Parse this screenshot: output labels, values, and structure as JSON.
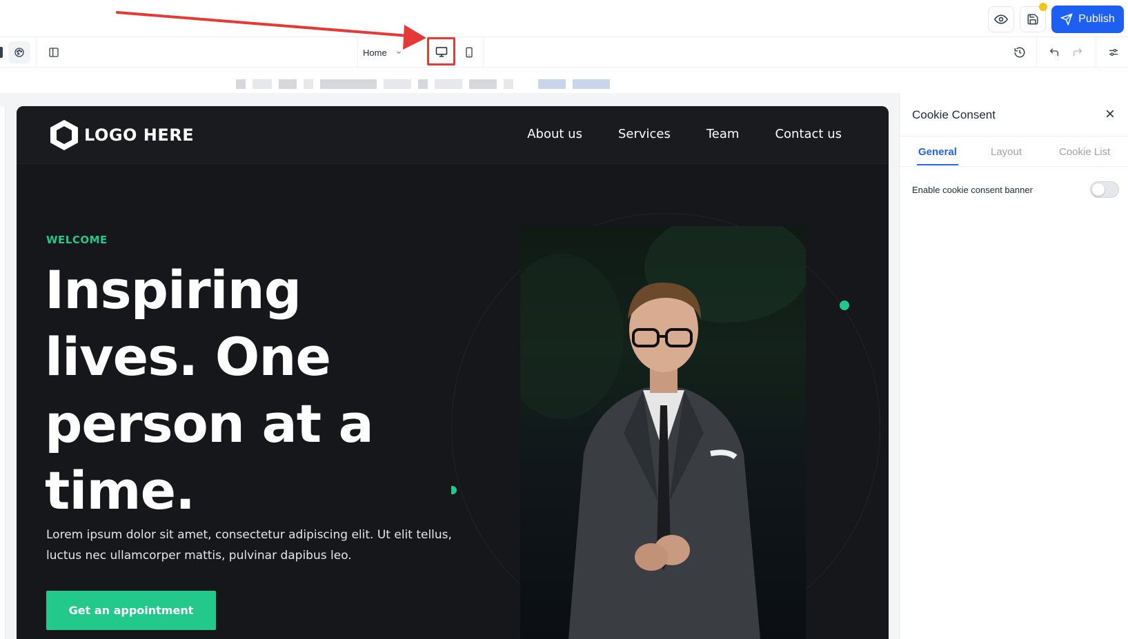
{
  "colors": {
    "accent_blue": "#1d5ff0",
    "brand_green": "#22c98a",
    "annotation_red": "#e53935",
    "notification_yellow": "#f5c518"
  },
  "topbar": {
    "preview_icon": "eye-icon",
    "save_icon": "floppy-disk-icon",
    "publish_label": "Publish",
    "publish_icon": "send-icon"
  },
  "toolbar": {
    "page_selector": {
      "selected": "Home"
    },
    "device": {
      "active": "desktop"
    }
  },
  "site": {
    "logo_text": "LOGO HERE",
    "nav": [
      "About us",
      "Services",
      "Team",
      "Contact us"
    ],
    "hero": {
      "kicker": "WELCOME",
      "title": "Inspiring lives. One person at a time.",
      "description": "Lorem ipsum dolor sit amet, consectetur adipiscing elit. Ut elit tellus, luctus nec ullamcorper mattis, pulvinar dapibus leo.",
      "cta_label": "Get an appointment"
    }
  },
  "panel": {
    "title": "Cookie Consent",
    "tabs": [
      "General",
      "Layout",
      "Cookie List"
    ],
    "active_tab": "General",
    "toggle_label": "Enable cookie consent banner",
    "toggle_on": false
  }
}
